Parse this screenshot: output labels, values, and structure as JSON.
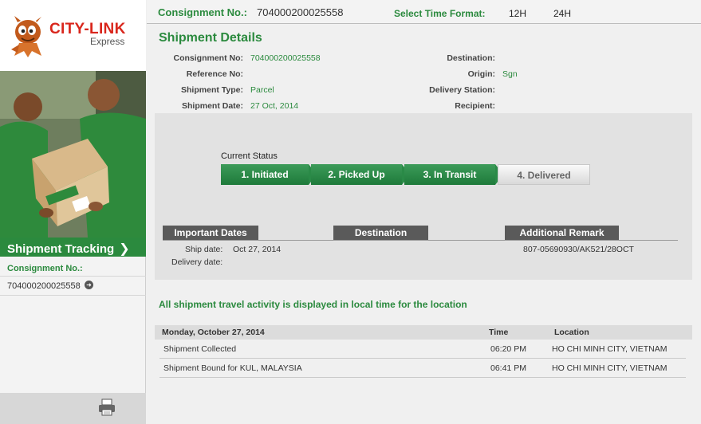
{
  "logo": {
    "brand": "CITY-LINK",
    "sub": "Express"
  },
  "sidebar": {
    "banner": "Shipment Tracking",
    "consignment_label": "Consignment No.:",
    "consignment_value": "704000200025558"
  },
  "topbar": {
    "consignment_label": "Consignment No.:",
    "consignment_value": "704000200025558",
    "time_format_label": "Select Time Format:",
    "opt_12h": "12H",
    "opt_24h": "24H"
  },
  "details": {
    "title": "Shipment Details",
    "left": [
      {
        "label": "Consignment No:",
        "value": "704000200025558"
      },
      {
        "label": "Reference No:",
        "value": ""
      },
      {
        "label": "Shipment Type:",
        "value": "Parcel"
      },
      {
        "label": "Shipment Date:",
        "value": "27 Oct, 2014"
      }
    ],
    "right": [
      {
        "label": "Destination:",
        "value": ""
      },
      {
        "label": "Origin:",
        "value": "Sgn"
      },
      {
        "label": "Delivery Station:",
        "value": ""
      },
      {
        "label": "Recipient:",
        "value": ""
      }
    ]
  },
  "status": {
    "label": "Current Status",
    "steps": [
      "1. Initiated",
      "2. Picked Up",
      "3. In Transit",
      "4. Delivered"
    ]
  },
  "summary": {
    "headers": [
      "Important Dates",
      "Destination",
      "Additional Remark"
    ],
    "ship_date_label": "Ship date:",
    "ship_date_value": "Oct 27, 2014",
    "delivery_date_label": "Delivery date:",
    "remark": "807-05690930/AK521/28OCT"
  },
  "activity": {
    "note": "All shipment travel activity is displayed in local time for the location",
    "date_header": "Monday, October 27, 2014",
    "time_header": "Time",
    "location_header": "Location",
    "rows": [
      {
        "event": "Shipment Collected",
        "time": "06:20 PM",
        "location": "HO CHI MINH CITY, VIETNAM"
      },
      {
        "event": "Shipment Bound for KUL, MALAYSIA",
        "time": "06:41 PM",
        "location": "HO CHI MINH CITY, VIETNAM"
      }
    ]
  },
  "colors": {
    "brand_green": "#2b8a3e",
    "brand_red": "#d9261c",
    "header_grey": "#5a5a5a"
  }
}
